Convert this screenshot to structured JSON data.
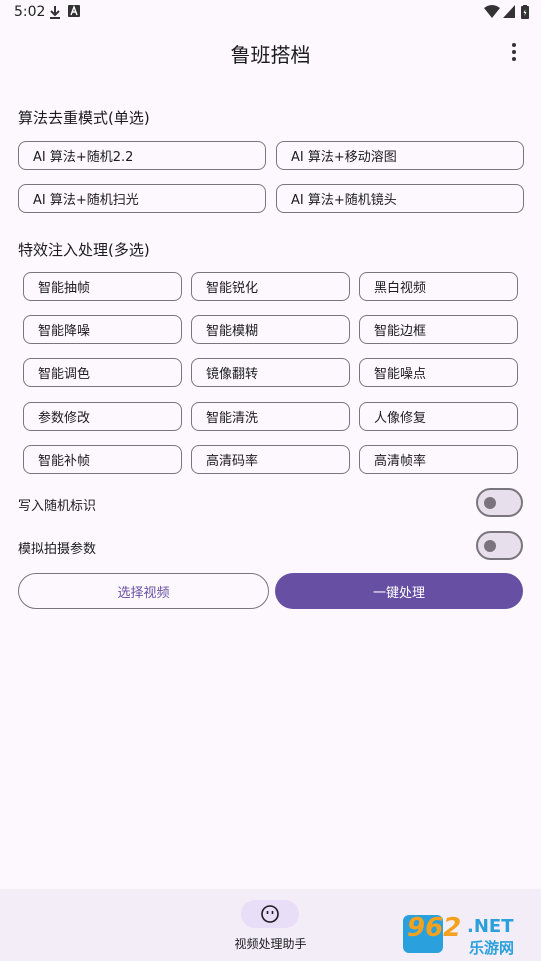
{
  "status_bar": {
    "time": "5:02"
  },
  "app": {
    "title": "鲁班搭档"
  },
  "mode_section": {
    "title": "算法去重模式(单选)",
    "options": [
      "AI 算法+随机2.2",
      "AI 算法+移动溶图",
      "AI 算法+随机扫光",
      "AI 算法+随机镜头"
    ]
  },
  "effects_section": {
    "title": "特效注入处理(多选)",
    "options": [
      "智能抽帧",
      "智能锐化",
      "黑白视频",
      "智能降噪",
      "智能模糊",
      "智能边框",
      "智能调色",
      "镜像翻转",
      "智能噪点",
      "参数修改",
      "智能清洗",
      "人像修复",
      "智能补帧",
      "高清码率",
      "高清帧率"
    ]
  },
  "toggles": {
    "random_id": {
      "label": "写入随机标识",
      "on": false
    },
    "shoot_params": {
      "label": "模拟拍摄参数",
      "on": false
    }
  },
  "actions": {
    "select_video": "选择视频",
    "process": "一键处理"
  },
  "bottom_nav": {
    "label": "视频处理助手",
    "icon": "face-icon"
  },
  "watermark": {
    "number": "962",
    "suffix": ".NET",
    "site": "乐游网"
  },
  "colors": {
    "primary": "#6750a4",
    "background": "#fdf8fd",
    "nav_background": "#f3edf7"
  }
}
